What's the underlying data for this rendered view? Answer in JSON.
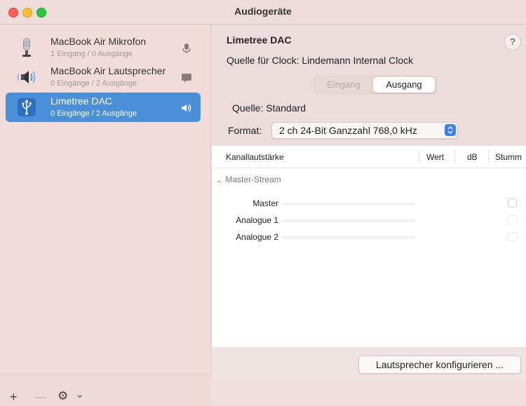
{
  "window": {
    "title": "Audiogeräte"
  },
  "devices": [
    {
      "name": "MacBook Air Mikrofon",
      "subtitle": "1 Eingang / 0 Ausgänge",
      "icon": "microphone-icon",
      "badge": "microphone-badge-icon",
      "selected": false
    },
    {
      "name": "MacBook Air Lautsprecher",
      "subtitle": "0 Eingänge / 2 Ausgänge",
      "icon": "speaker-icon",
      "badge": "speech-bubble-icon",
      "selected": false
    },
    {
      "name": "Limetree DAC",
      "subtitle": "0 Eingänge / 2 Ausgänge",
      "icon": "usb-icon",
      "badge": "volume-icon",
      "selected": true
    }
  ],
  "toolbar": {
    "add": "+",
    "remove": "—",
    "action": "⚙",
    "chevron": "⌄"
  },
  "detail": {
    "device_name": "Limetree DAC",
    "help": "?",
    "clock_label": "Quelle für Clock:",
    "clock_value": "Lindemann Internal Clock",
    "tabs": {
      "input": "Eingang",
      "output": "Ausgang",
      "selected": "Ausgang"
    },
    "source_label": "Quelle:",
    "source_value": "Standard",
    "format_label": "Format:",
    "format_value": "2 ch 24-Bit Ganzzahl 768,0 kHz"
  },
  "table": {
    "headers": {
      "channel": "Kanallautstärke",
      "value": "Wert",
      "db": "dB",
      "mute": "Stumm"
    },
    "group": "Master-Stream",
    "rows": [
      {
        "label": "Master"
      },
      {
        "label": "Analogue 1"
      },
      {
        "label": "Analogue 2"
      }
    ]
  },
  "footer": {
    "configure_button": "Lautsprecher konfigurieren ..."
  },
  "colors": {
    "selection": "#4a90d9",
    "accent_button": "#3b82f6",
    "close": "#ff5f57",
    "minimize": "#febc2e",
    "maximize": "#28c840"
  }
}
